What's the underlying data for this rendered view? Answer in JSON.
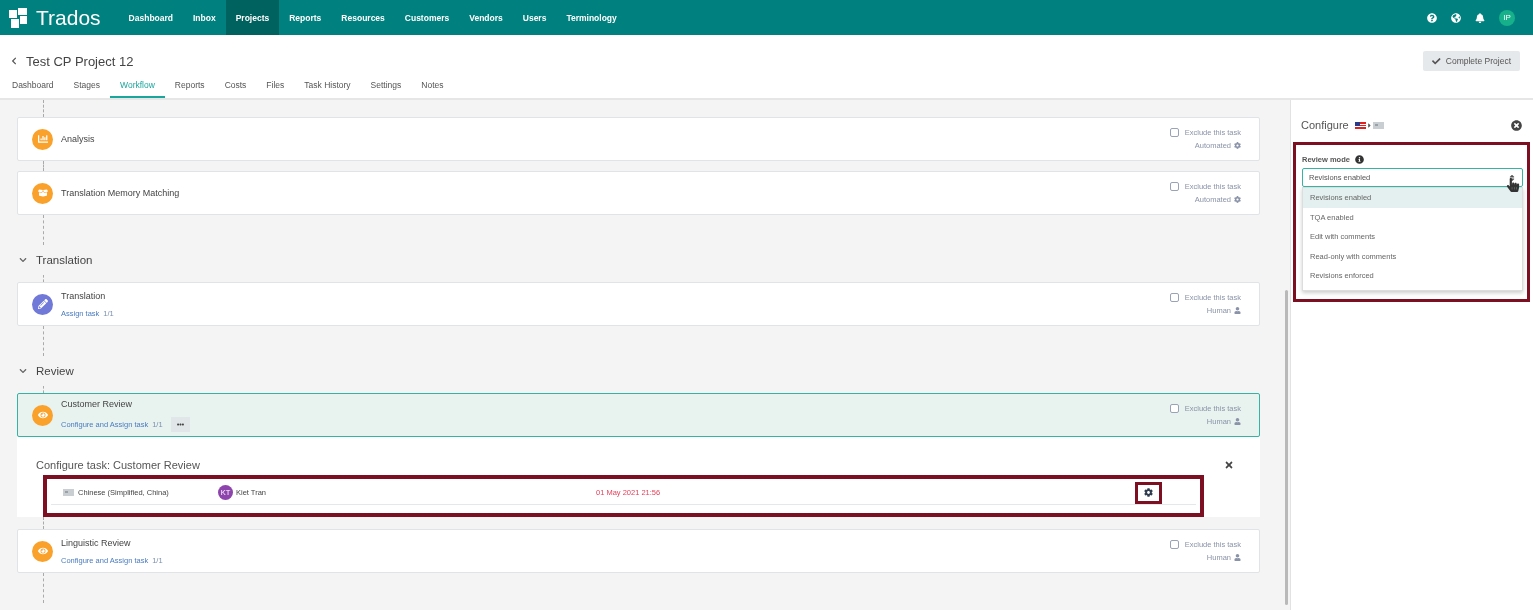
{
  "nav": {
    "logo": "Trados",
    "items": [
      {
        "label": "Dashboard",
        "selected": false
      },
      {
        "label": "Inbox",
        "selected": false
      },
      {
        "label": "Projects",
        "selected": true
      },
      {
        "label": "Reports",
        "selected": false
      },
      {
        "label": "Resources",
        "selected": false
      },
      {
        "label": "Customers",
        "selected": false
      },
      {
        "label": "Vendors",
        "selected": false
      },
      {
        "label": "Users",
        "selected": false
      },
      {
        "label": "Terminology",
        "selected": false
      }
    ],
    "user_initials": "IP"
  },
  "project": {
    "title": "Test CP Project 12",
    "complete_button": "Complete Project",
    "tabs": [
      {
        "label": "Dashboard",
        "selected": false
      },
      {
        "label": "Stages",
        "selected": false
      },
      {
        "label": "Workflow",
        "selected": true
      },
      {
        "label": "Reports",
        "selected": false
      },
      {
        "label": "Costs",
        "selected": false
      },
      {
        "label": "Files",
        "selected": false
      },
      {
        "label": "Task History",
        "selected": false
      },
      {
        "label": "Settings",
        "selected": false
      },
      {
        "label": "Notes",
        "selected": false
      }
    ]
  },
  "workflow": {
    "stages": [
      {
        "tasks": [
          {
            "name": "Analysis",
            "kind": "analysis",
            "color": "#f9a12b",
            "selected": false,
            "exclude_label": "Exclude this task",
            "excluded": false,
            "type": {
              "kind": "automated",
              "label": "Automated"
            }
          },
          {
            "name": "Translation Memory Matching",
            "kind": "matching",
            "color": "#f9a12b",
            "selected": false,
            "exclude_label": "Exclude this task",
            "excluded": false,
            "type": {
              "kind": "automated",
              "label": "Automated"
            }
          }
        ]
      },
      {
        "header": "Translation",
        "expanded": true,
        "tasks": [
          {
            "name": "Translation",
            "kind": "translation",
            "color": "#7078d8",
            "link": "Assign task",
            "count": "1/1",
            "selected": false,
            "exclude_label": "Exclude this task",
            "excluded": false,
            "type": {
              "kind": "human",
              "label": "Human"
            }
          }
        ]
      },
      {
        "header": "Review",
        "expanded": true,
        "tasks": [
          {
            "name": "Customer Review",
            "kind": "review",
            "color": "#f9a12b",
            "link": "Configure and Assign task",
            "count": "1/1",
            "more": true,
            "selected": true,
            "exclude_label": "Exclude this task",
            "excluded": false,
            "type": {
              "kind": "human",
              "label": "Human"
            },
            "configure": {
              "title": "Configure task: Customer Review",
              "rows": [
                {
                  "language": "Chinese (Simplified, China)",
                  "assignee_initials": "KT",
                  "assignee": "Kiet Tran",
                  "due": "01 May 2021 21:56",
                  "highlighted": true
                }
              ]
            }
          },
          {
            "name": "Linguistic Review",
            "kind": "review",
            "color": "#f9a12b",
            "link": "Configure and Assign task",
            "count": "1/1",
            "selected": false,
            "exclude_label": "Exclude this task",
            "excluded": false,
            "type": {
              "kind": "human",
              "label": "Human"
            }
          }
        ]
      }
    ]
  },
  "configure_panel": {
    "title": "Configure",
    "review_mode": {
      "label": "Review mode",
      "value": "Revisions enabled",
      "highlighted": true,
      "options": [
        {
          "label": "Revisions enabled",
          "selected": true
        },
        {
          "label": "TQA enabled",
          "selected": false
        },
        {
          "label": "Edit with comments",
          "selected": false
        },
        {
          "label": "Read-only with comments",
          "selected": false
        },
        {
          "label": "Revisions enforced",
          "selected": false
        }
      ]
    }
  }
}
